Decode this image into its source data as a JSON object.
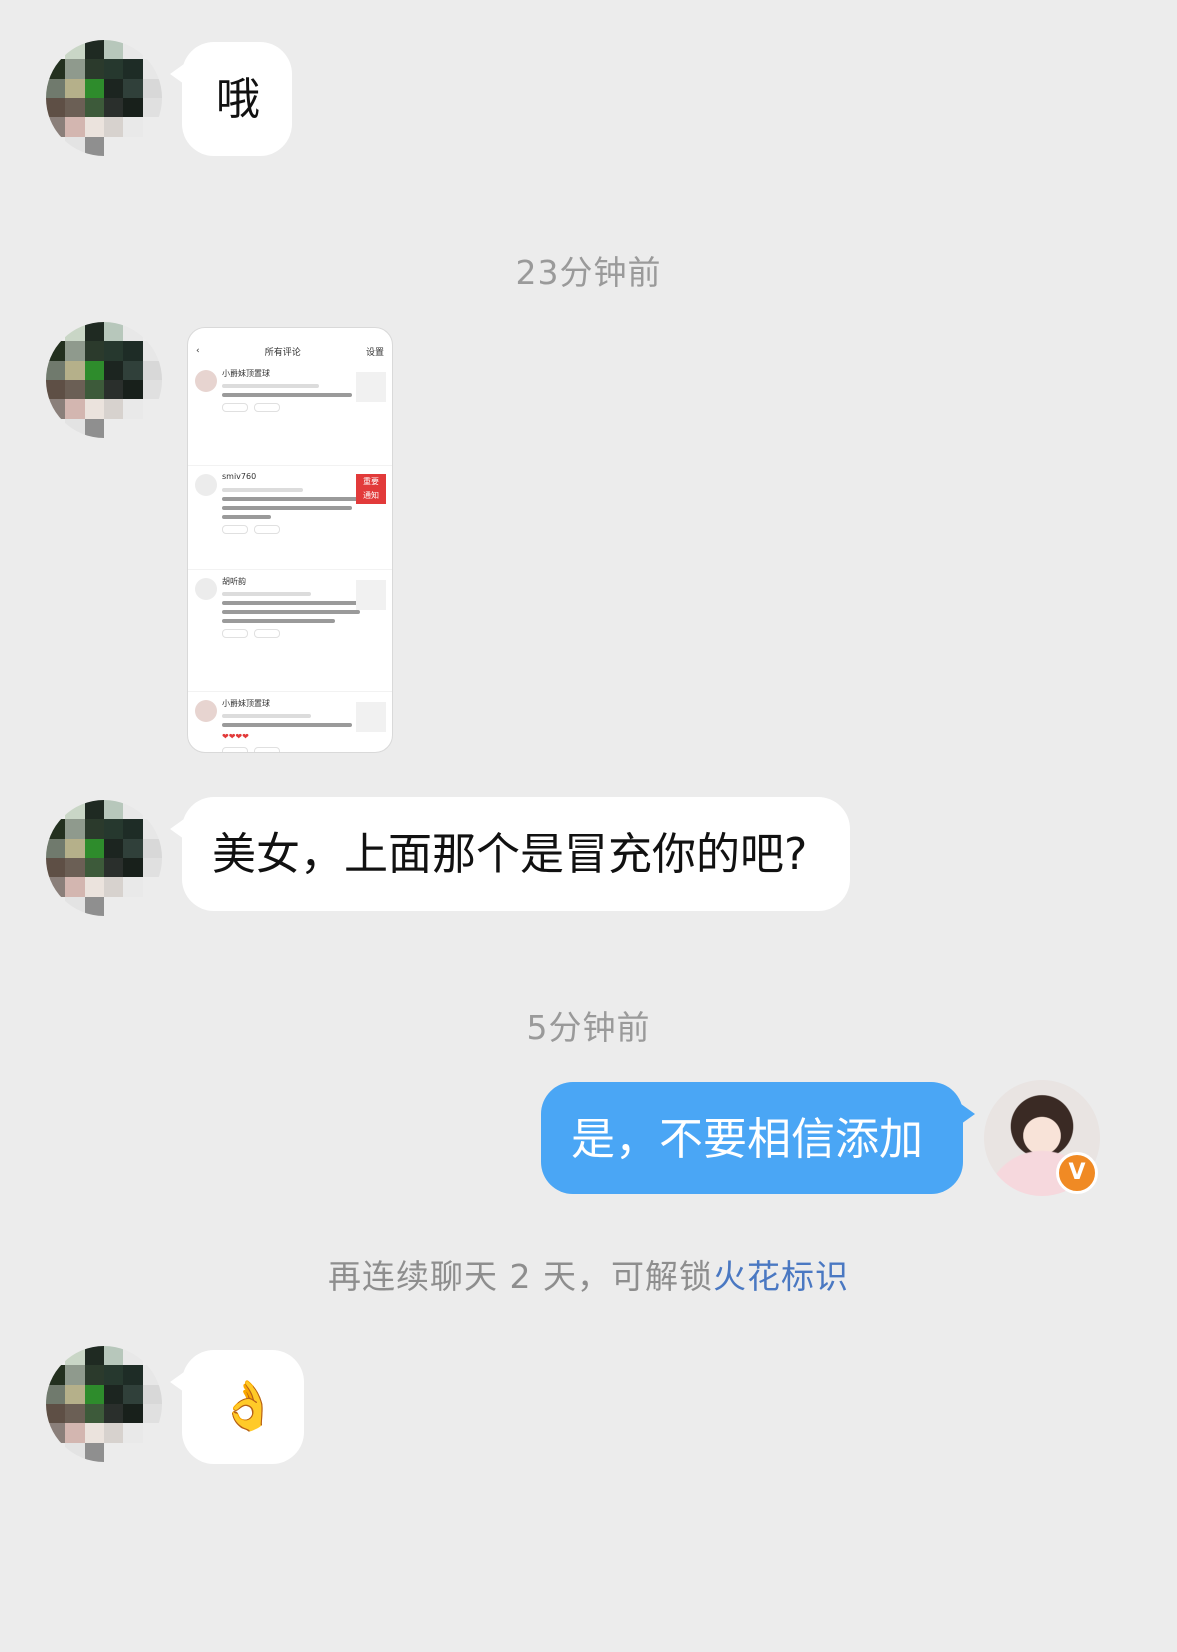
{
  "messages": {
    "m1_text": "哦",
    "m3_text": "美女，上面那个是冒充你的吧?",
    "m4_text": "是，不要相信添加",
    "m5_emoji": "👌"
  },
  "times": {
    "t1": "23分钟前",
    "t2": "5分钟前"
  },
  "notice": {
    "prefix": "再连续聊天 2 天，可解锁",
    "link": "火花标识"
  },
  "screenshot": {
    "header_title": "所有评论",
    "header_right": "设置",
    "c1_name": "小爵妹顶置球",
    "c2_name": "smiv760",
    "c2_badge_line1": "重要",
    "c2_badge_line2": "通知",
    "c3_name": "胡听韵",
    "c4_name": "小爵妹顶置球",
    "c4_hearts": "❤❤❤❤"
  },
  "badge": {
    "verified_letter": "V"
  }
}
